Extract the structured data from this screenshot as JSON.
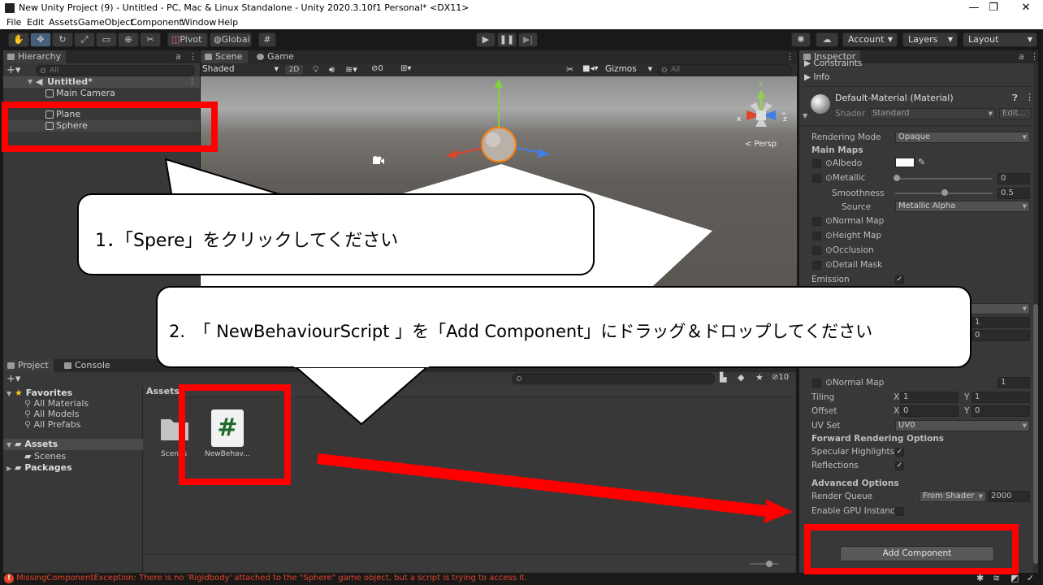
{
  "window": {
    "title": "New Unity Project (9) - Untitled - PC, Mac & Linux Standalone - Unity 2020.3.10f1 Personal* <DX11>",
    "minimize": "—",
    "maximize": "❐",
    "close": "✕"
  },
  "menu": [
    "File",
    "Edit",
    "Assets",
    "GameObject",
    "Component",
    "Window",
    "Help"
  ],
  "toolbar": {
    "pivot_label": "Pivot",
    "global_label": "Global",
    "account_label": "Account",
    "layers_label": "Layers",
    "layout_label": "Layout"
  },
  "hierarchy": {
    "tab_label": "Hierarchy",
    "search_placeholder": "All",
    "scene_name": "Untitled*",
    "items": [
      "Main Camera",
      "Plane",
      "Sphere"
    ]
  },
  "scene": {
    "tabs": [
      "Scene",
      "Game"
    ],
    "shading_mode": "Shaded",
    "mode_2d": "2D",
    "hidden_count": "0",
    "gizmos_label": "Gizmos",
    "search_placeholder": "All",
    "persp_label": "< Persp",
    "axes": {
      "x": "x",
      "y": "y",
      "z": "z"
    }
  },
  "project": {
    "tabs": [
      "Project",
      "Console"
    ],
    "favorites_label": "Favorites",
    "favorites": [
      "All Materials",
      "All Models",
      "All Prefabs"
    ],
    "assets_label": "Assets",
    "asset_folders": [
      "Scenes"
    ],
    "packages_label": "Packages",
    "breadcrumb": "Assets",
    "hidden_count": "10",
    "assets": [
      {
        "name": "Scenes",
        "type": "folder"
      },
      {
        "name": "NewBehav...",
        "type": "script"
      }
    ]
  },
  "inspector": {
    "tab_label": "Inspector",
    "constraints_label": "Constraints",
    "info_label": "Info",
    "material_name": "Default-Material (Material)",
    "shader_label": "Shader",
    "shader_value": "Standard",
    "edit_button": "Edit...",
    "rendering_mode_label": "Rendering Mode",
    "rendering_mode_value": "Opaque",
    "main_maps_label": "Main Maps",
    "albedo_label": "Albedo",
    "metallic_label": "Metallic",
    "metallic_value": "0",
    "smoothness_label": "Smoothness",
    "smoothness_value": "0.5",
    "source_label": "Source",
    "source_value": "Metallic Alpha",
    "normal_map_label": "Normal Map",
    "height_map_label": "Height Map",
    "occlusion_label": "Occlusion",
    "detail_mask_label": "Detail Mask",
    "emission_label": "Emission",
    "field_1": "1",
    "field_0": "0",
    "secondary_normal_label": "Normal Map",
    "secondary_normal_value": "1",
    "tiling_label": "Tiling",
    "tiling_x": "1",
    "tiling_y": "1",
    "offset_label": "Offset",
    "offset_x": "0",
    "offset_y": "0",
    "uv_set_label": "UV Set",
    "uv_set_value": "UV0",
    "axis_x": "X",
    "axis_y": "Y",
    "forward_options_label": "Forward Rendering Options",
    "specular_label": "Specular Highlights",
    "reflections_label": "Reflections",
    "advanced_label": "Advanced Options",
    "render_queue_label": "Render Queue",
    "render_queue_source": "From Shader",
    "render_queue_value": "2000",
    "gpu_instancing_label": "Enable GPU Instancin",
    "add_component_label": "Add Component"
  },
  "status": {
    "error_message": "MissingComponentException: There is no 'Rigidbody' attached to the \"Sphere\" game object, but a script is trying to access it."
  },
  "annotations": {
    "step1": "1．「Spere」をクリックしてください",
    "step2": "2.　「 NewBehaviourScript 」を「Add Component」にドラッグ＆ドロップしてください",
    "red_color": "#ff0000"
  }
}
